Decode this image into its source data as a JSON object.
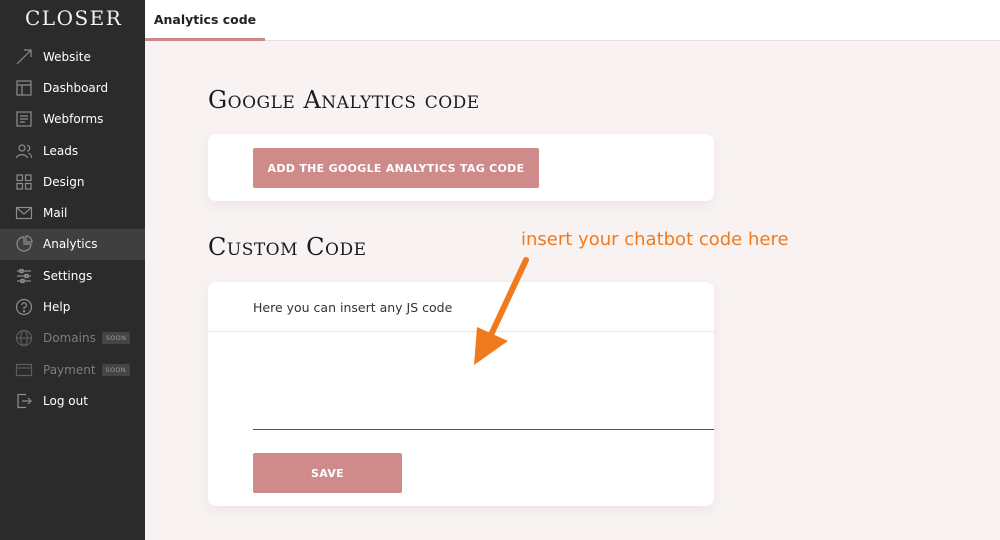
{
  "app": {
    "brand": "CLOSER"
  },
  "sidebar": {
    "items": [
      {
        "label": "Website",
        "icon": "cursor-icon"
      },
      {
        "label": "Dashboard",
        "icon": "dashboard-icon"
      },
      {
        "label": "Webforms",
        "icon": "form-icon"
      },
      {
        "label": "Leads",
        "icon": "users-icon"
      },
      {
        "label": "Design",
        "icon": "grid-icon"
      },
      {
        "label": "Mail",
        "icon": "mail-icon"
      },
      {
        "label": "Analytics",
        "icon": "pie-chart-icon",
        "active": true
      },
      {
        "label": "Settings",
        "icon": "sliders-icon"
      },
      {
        "label": "Help",
        "icon": "help-icon"
      },
      {
        "label": "Domains",
        "icon": "globe-icon",
        "badge": "SOON",
        "disabled": true
      },
      {
        "label": "Payment",
        "icon": "card-icon",
        "badge": "SOON",
        "disabled": true
      },
      {
        "label": "Log out",
        "icon": "logout-icon"
      }
    ]
  },
  "header": {
    "tab_label": "Analytics code"
  },
  "google_section": {
    "title": "Google Analytics code",
    "button_label": "ADD THE GOOGLE ANALYTICS TAG CODE"
  },
  "custom_section": {
    "title": "Custom Code",
    "hint": "Here you can insert any JS code",
    "code_value": "",
    "save_label": "SAVE"
  },
  "annotation": {
    "text": "insert your chatbot code here"
  },
  "colors": {
    "accent": "#cf8a8a",
    "sidebar_bg": "#2b2b2b",
    "content_bg": "#f8f3f2",
    "annotation": "#f07a1e"
  }
}
